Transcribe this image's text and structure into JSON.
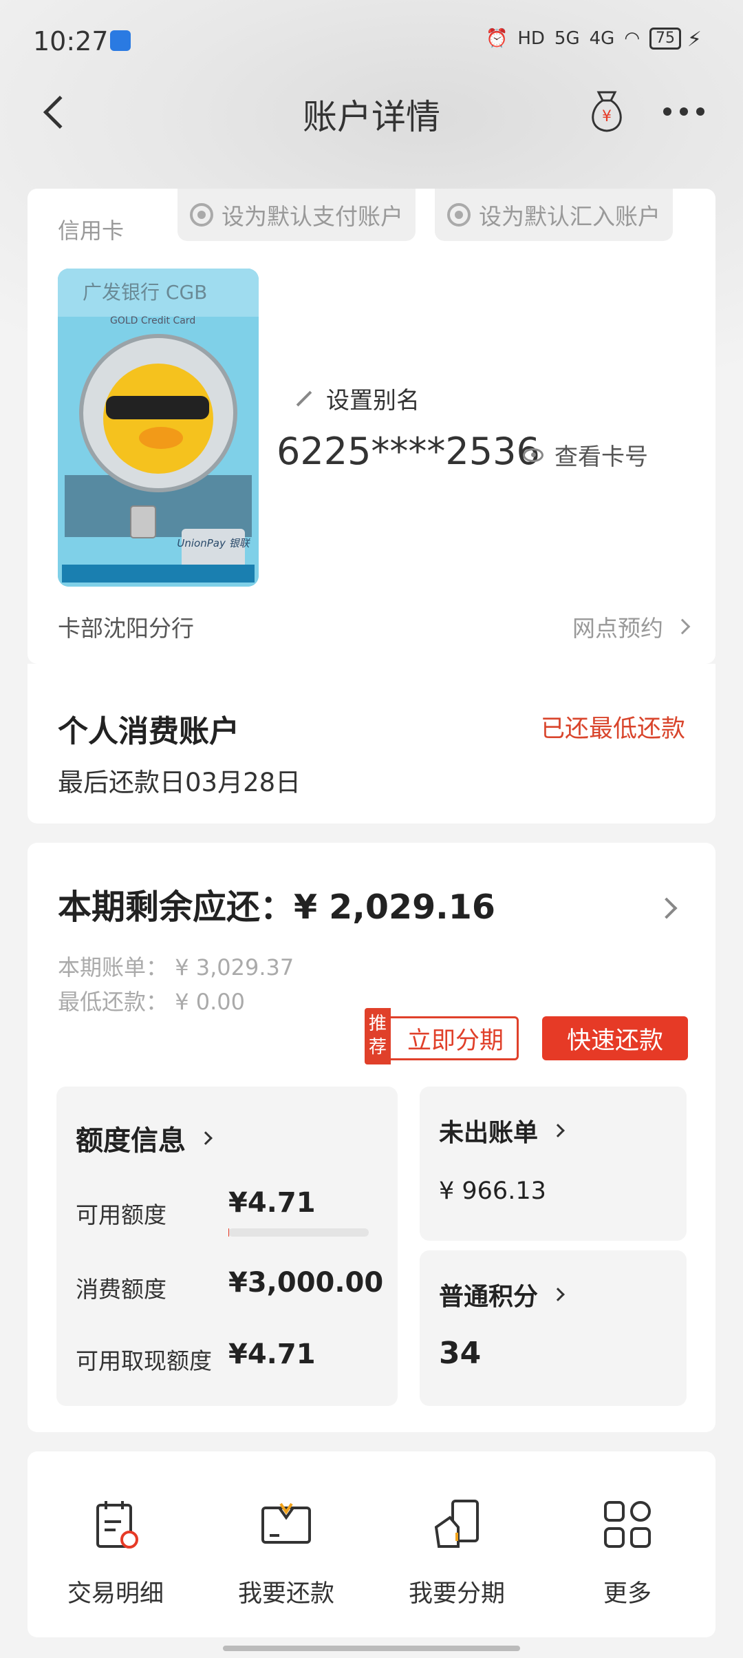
{
  "status_bar": {
    "time": "10:27",
    "network_1": "5G",
    "network_2": "4G",
    "battery": "75"
  },
  "nav": {
    "title": "账户详情"
  },
  "card_info": {
    "type_label": "信用卡",
    "set_default_pay": "设为默认支付账户",
    "set_default_receive": "设为默认汇入账户",
    "card_brand_text": "广发银行 CGB",
    "card_sub_text": "GOLD Credit Card",
    "card_network_text": "UnionPay 银联",
    "set_alias": "设置别名",
    "card_number": "6225****2536",
    "view_card_no": "查看卡号",
    "branch": "卡部沈阳分行",
    "appointment": "网点预约"
  },
  "account": {
    "name": "个人消费账户",
    "status": "已还最低还款",
    "due_date": "最后还款日03月28日"
  },
  "bill": {
    "remaining_label": "本期剩余应还：",
    "remaining_amount": "¥ 2,029.16",
    "statement_label": "本期账单：",
    "statement_amount": "¥ 3,029.37",
    "min_payment_label": "最低还款：",
    "min_payment_amount": "¥ 0.00",
    "recommend_tag": "推荐",
    "installment_button": "立即分期",
    "quick_pay_button": "快速还款"
  },
  "limit": {
    "title": "额度信息",
    "available_label": "可用额度",
    "available_value": "¥4.71",
    "available_fraction": 0.0016,
    "consumption_label": "消费额度",
    "consumption_value": "¥3,000.00",
    "cash_label": "可用取现额度",
    "cash_value": "¥4.71"
  },
  "unbilled": {
    "title": "未出账单",
    "amount": "¥ 966.13"
  },
  "points": {
    "title": "普通积分",
    "value": "34"
  },
  "shortcuts": [
    {
      "label": "交易明细",
      "icon": "transaction-list-icon"
    },
    {
      "label": "我要还款",
      "icon": "repay-envelope-icon"
    },
    {
      "label": "我要分期",
      "icon": "installment-card-icon"
    },
    {
      "label": "更多",
      "icon": "grid-more-icon"
    }
  ],
  "colors": {
    "accent_red": "#e63a26",
    "status_red": "#d9452c"
  }
}
